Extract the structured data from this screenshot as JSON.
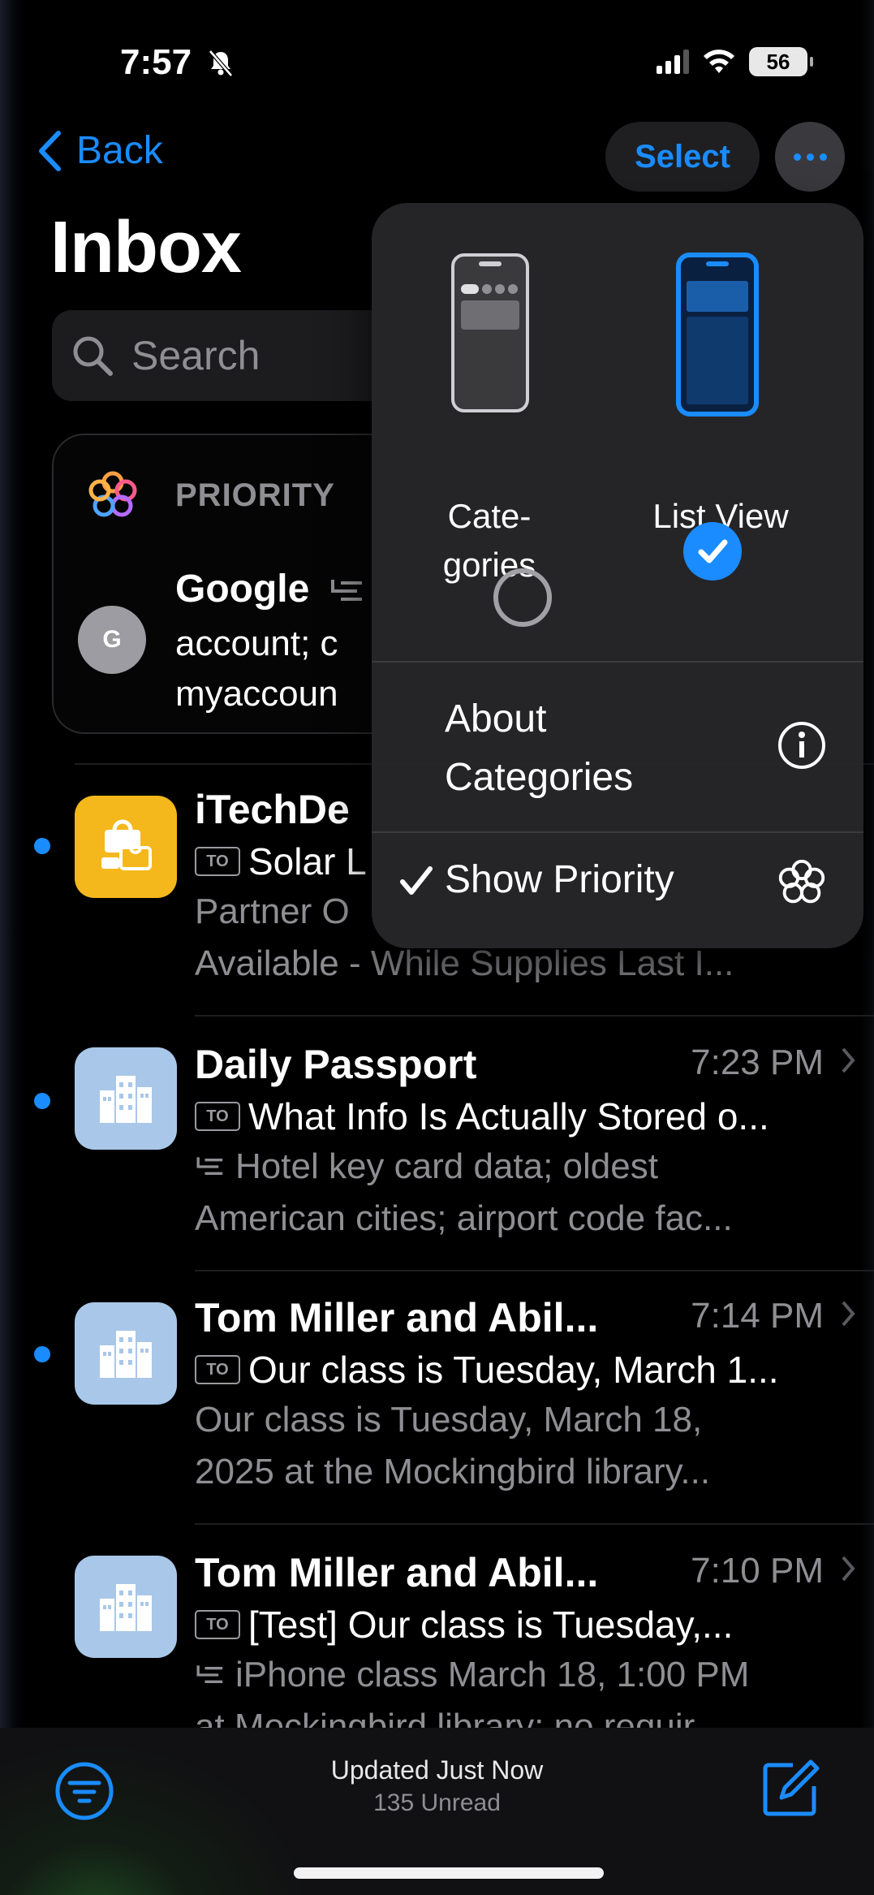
{
  "status": {
    "time": "7:57",
    "battery": "56"
  },
  "nav": {
    "back_label": "Back",
    "select_label": "Select"
  },
  "title": "Inbox",
  "search": {
    "placeholder": "Search"
  },
  "priority": {
    "label": "PRIORITY",
    "avatar_initial": "G",
    "sender": "Google",
    "line1": "account; c",
    "line2": "myaccoun"
  },
  "mails": [
    {
      "sender": "iTechDe",
      "subject": "Solar L",
      "preview1": "Partner O",
      "preview2": "Available - While Supplies Last I...",
      "unread": true,
      "icon": "shopping-bag-icon",
      "icon_bg": "#f4b81c"
    },
    {
      "sender": "Daily Passport",
      "time": "7:23 PM",
      "subject": "What Info Is Actually Stored o...",
      "preview1": "Hotel key card data; oldest",
      "preview2": "American cities; airport code fac...",
      "unread": true,
      "icon": "building-icon",
      "icon_bg": "#a9c7e8"
    },
    {
      "sender": "Tom Miller and Abil...",
      "time": "7:14 PM",
      "subject": "Our class is Tuesday, March 1...",
      "preview1": "Our class is Tuesday, March 18,",
      "preview2": "2025 at the Mockingbird library...",
      "unread": true,
      "icon": "building-icon",
      "icon_bg": "#a9c7e8"
    },
    {
      "sender": "Tom Miller and Abil...",
      "time": "7:10 PM",
      "subject": "[Test] Our class is Tuesday,...",
      "preview1": "iPhone class March 18, 1:00 PM",
      "preview2": "at Mockingbird library; no requir...",
      "unread": false,
      "icon": "building-icon",
      "icon_bg": "#a9c7e8"
    }
  ],
  "menu": {
    "categories_label_line1": "Cate-",
    "categories_label_line2": "gories",
    "list_view_label": "List View",
    "about_line1": "About",
    "about_line2": "Categories",
    "show_priority": "Show Priority",
    "selected": "List View"
  },
  "toolbar": {
    "updated": "Updated Just Now",
    "unread": "135 Unread"
  },
  "colors": {
    "accent": "#1a8cff",
    "menu_bg": "#262628"
  }
}
